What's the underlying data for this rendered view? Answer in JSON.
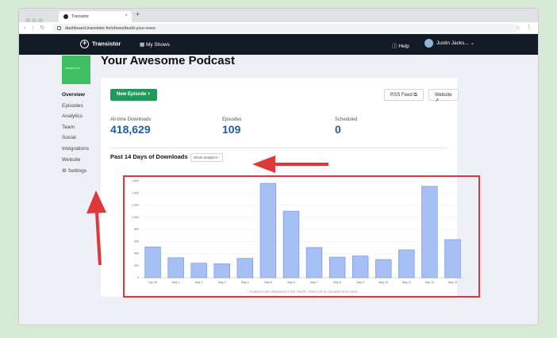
{
  "browser": {
    "tab_title": "Transistor",
    "new_tab": "+",
    "url": "dashboard.transistor.fm/shows/build-your-exes",
    "nav": "‹ › ↻",
    "star": "☆",
    "menu": "⋮"
  },
  "appbar": {
    "logo": "Transistor",
    "my_shows": "My Shows",
    "help": "Help",
    "user": "Justin Jacks...",
    "chevron": "⌄"
  },
  "show_art_text": "SUPER F1 01",
  "sidebar": {
    "items": [
      {
        "label": "Overview",
        "active": true
      },
      {
        "label": "Episodes"
      },
      {
        "label": "Analytics"
      },
      {
        "label": "Team"
      },
      {
        "label": "Social"
      },
      {
        "label": "Integrations"
      },
      {
        "label": "Website"
      },
      {
        "label": "Settings",
        "icon": "gear-icon"
      }
    ]
  },
  "page_title": "Your Awesome Podcast",
  "actions": {
    "new_episode": "New Episode  +",
    "rss_feed": "RSS Feed  ⧉",
    "website": "Website  ↗"
  },
  "stats": {
    "all_time_label": "All-time Downloads",
    "all_time_value": "418,629",
    "episodes_label": "Episodes",
    "episodes_value": "109",
    "scheduled_label": "Scheduled",
    "scheduled_value": "0"
  },
  "chart_section": {
    "title": "Past 14 Days of Downloads",
    "show_analytics": "Show analytics ›",
    "note": "* Analytics are displayed in the Pacific Time (US & Canada) time zone."
  },
  "chart_data": {
    "type": "bar",
    "categories": [
      "Apr 30",
      "May 1",
      "May 2",
      "May 3",
      "May 4",
      "May 5",
      "May 6",
      "May 7",
      "May 8",
      "May 9",
      "May 10",
      "May 11",
      "May 12",
      "May 13"
    ],
    "values": [
      510,
      330,
      240,
      230,
      320,
      1560,
      1100,
      500,
      340,
      360,
      300,
      460,
      1510,
      630
    ],
    "ylim": [
      0,
      1600
    ],
    "yticks": [
      "0",
      "200",
      "400",
      "600",
      "800",
      "1,000",
      "1,200",
      "1,400",
      "1,600"
    ],
    "grid": true,
    "bar_color": "#a6c0f5"
  },
  "colors": {
    "accent_green": "#1f9a5c",
    "stat_blue": "#1d5fa8",
    "annotation_red": "#e03838"
  }
}
